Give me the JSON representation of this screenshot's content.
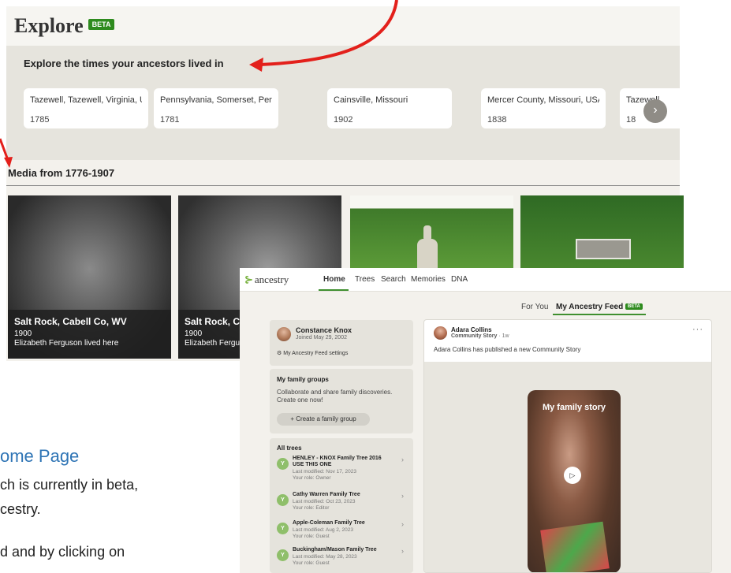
{
  "explore": {
    "title": "Explore",
    "beta_badge": "BETA",
    "times_heading": "Explore the times your ancestors lived in",
    "places": [
      {
        "name": "Tazewell, Tazewell, Virginia, U...",
        "year": "1785"
      },
      {
        "name": "Pennsylvania, Somerset, Penn...",
        "year": "1781"
      },
      {
        "name": "Cainsville, Missouri",
        "year": "1902"
      },
      {
        "name": "Mercer County, Missouri, USA",
        "year": "1838"
      },
      {
        "name": "Tazewell",
        "year": "18"
      }
    ],
    "next_icon": "›",
    "media_heading": "Media from 1776-1907",
    "media": [
      {
        "title": "Salt Rock, Cabell Co, WV",
        "year": "1900",
        "subtitle": "Elizabeth Ferguson lived here"
      },
      {
        "title": "Salt Rock, C",
        "year": "1900",
        "subtitle": "Elizabeth Fergu"
      }
    ]
  },
  "document": {
    "heading": "ome Page",
    "line1": "ch is currently in beta,",
    "line2": "cestry.",
    "line3": "d and by clicking on"
  },
  "ancestry": {
    "logo_text": "ancestry",
    "nav": [
      "Home",
      "Trees",
      "Search",
      "Memories",
      "DNA"
    ],
    "subtabs": {
      "for_you": "For You",
      "feed": "My Ancestry Feed",
      "feed_badge": "BETA"
    },
    "profile": {
      "name": "Constance Knox",
      "joined": "Joined May 29, 2002",
      "settings": "My Ancestry Feed settings"
    },
    "groups": {
      "title": "My family groups",
      "desc": "Collaborate and share family discoveries. Create one now!",
      "button": "+ Create a family group"
    },
    "trees": {
      "title": "All trees",
      "items": [
        {
          "name": "HENLEY - KNOX Family Tree 2016 USE THIS ONE",
          "modified": "Last modified: Nov 17, 2023",
          "role": "Your role: Owner"
        },
        {
          "name": "Cathy Warren Family Tree",
          "modified": "Last modified: Oct 23, 2023",
          "role": "Your role: Editor"
        },
        {
          "name": "Apple-Coleman Family Tree",
          "modified": "Last modified: Aug 2, 2023",
          "role": "Your role: Guest"
        },
        {
          "name": "Buckingham/Mason Family Tree",
          "modified": "Last modified: May 28, 2023",
          "role": "Your role: Guest"
        }
      ]
    },
    "feed": {
      "name": "Adara Collins",
      "type": "Community Story",
      "ago": "· 1w",
      "text": "Adara Collins has published a new Community Story",
      "story_title": "My family story",
      "more_icon": "···",
      "play_icon": "▷"
    }
  },
  "colors": {
    "accent_green": "#2e8b1e",
    "arrow_red": "#e3201b",
    "link_blue": "#2e74b5"
  }
}
